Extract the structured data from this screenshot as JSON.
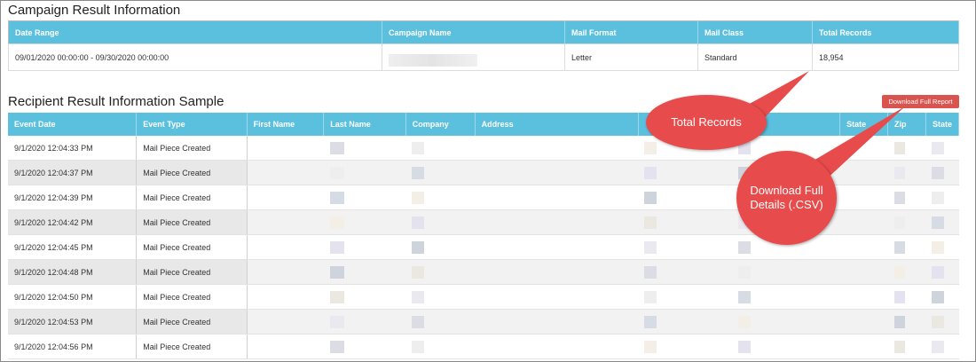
{
  "campaign": {
    "title": "Campaign Result Information",
    "headers": [
      "Date Range",
      "Campaign Name",
      "Mail Format",
      "Mail Class",
      "Total Records"
    ],
    "row": {
      "date_range": "09/01/2020 00:00:00 - 09/30/2020 00:00:00",
      "campaign_name": "",
      "mail_format": "Letter",
      "mail_class": "Standard",
      "total_records": "18,954"
    }
  },
  "recipients": {
    "title": "Recipient Result Information Sample",
    "download_label": "Download Full Report",
    "headers": [
      "Event Date",
      "Event Type",
      "First Name",
      "Last Name",
      "Company",
      "Address",
      "",
      "",
      "State",
      "Zip",
      "State"
    ],
    "rows": [
      {
        "date": "9/1/2020 12:04:33 PM",
        "type": "Mail Piece Created"
      },
      {
        "date": "9/1/2020 12:04:37 PM",
        "type": "Mail Piece Created"
      },
      {
        "date": "9/1/2020 12:04:39 PM",
        "type": "Mail Piece Created"
      },
      {
        "date": "9/1/2020 12:04:42 PM",
        "type": "Mail Piece Created"
      },
      {
        "date": "9/1/2020 12:04:45 PM",
        "type": "Mail Piece Created"
      },
      {
        "date": "9/1/2020 12:04:48 PM",
        "type": "Mail Piece Created"
      },
      {
        "date": "9/1/2020 12:04:50 PM",
        "type": "Mail Piece Created"
      },
      {
        "date": "9/1/2020 12:04:53 PM",
        "type": "Mail Piece Created"
      },
      {
        "date": "9/1/2020 12:04:56 PM",
        "type": "Mail Piece Created"
      }
    ]
  },
  "callouts": {
    "records": "Total Records",
    "download_line1": "Download Full",
    "download_line2": "Details (.CSV)"
  },
  "colors": {
    "header": "#5bc0de",
    "button": "#d9534f",
    "callout": "#e84b4b"
  }
}
